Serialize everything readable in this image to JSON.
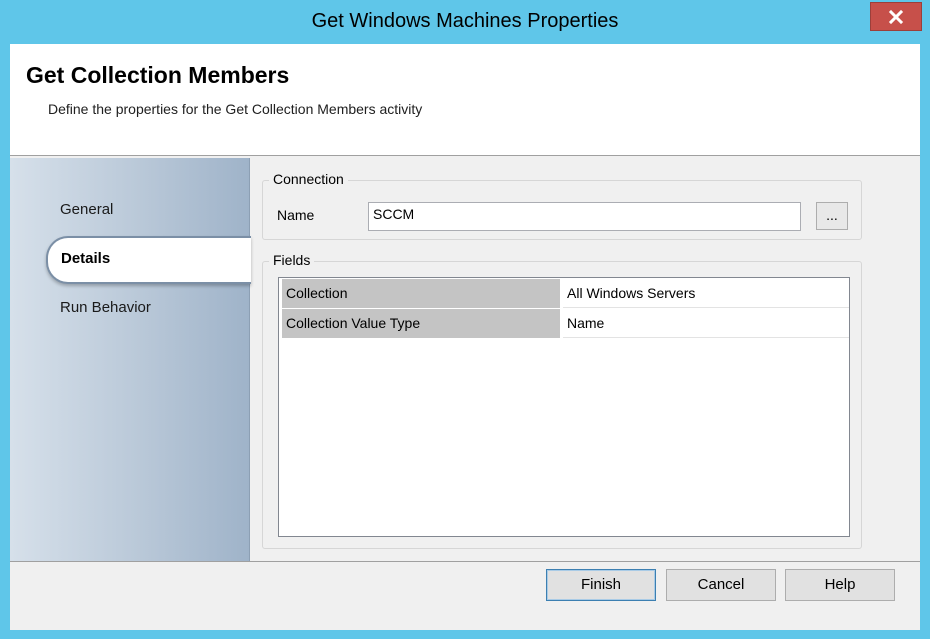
{
  "window": {
    "title": "Get Windows Machines Properties",
    "close_glyph": "✕"
  },
  "header": {
    "title": "Get Collection Members",
    "subtitle": "Define the properties for the Get Collection Members activity"
  },
  "sidebar": {
    "items": [
      {
        "label": "General",
        "selected": false
      },
      {
        "label": "Details",
        "selected": true
      },
      {
        "label": "Run Behavior",
        "selected": false
      }
    ]
  },
  "connection": {
    "group_label": "Connection",
    "name_label": "Name",
    "name_value": "SCCM",
    "browse_label": "..."
  },
  "fields": {
    "group_label": "Fields",
    "rows": [
      {
        "key": "Collection",
        "value": "All Windows Servers"
      },
      {
        "key": "Collection Value Type",
        "value": "Name"
      }
    ]
  },
  "buttons": {
    "finish": "Finish",
    "cancel": "Cancel",
    "help": "Help"
  },
  "colors": {
    "title_bar": "#5fc6e9",
    "close_button": "#c7504a"
  }
}
